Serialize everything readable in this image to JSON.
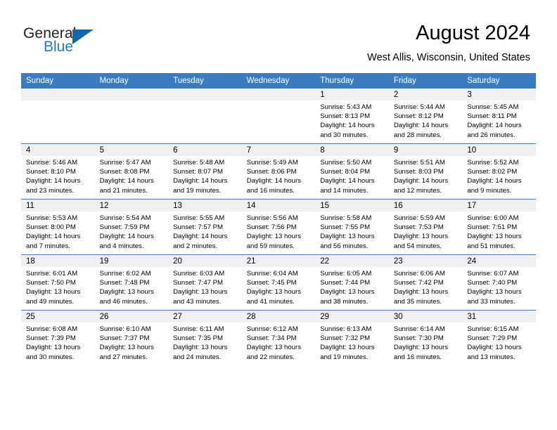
{
  "brand": {
    "name_part1": "General",
    "name_part2": "Blue",
    "triangle_color": "#1166ad",
    "blue_color": "#1f7ac4"
  },
  "header": {
    "title": "August 2024",
    "location": "West Allis, Wisconsin, United States"
  },
  "theme": {
    "header_bar": "#3a7cc0",
    "day_band": "#f0f0f0",
    "text": "#000000"
  },
  "weekday_headers": [
    "Sunday",
    "Monday",
    "Tuesday",
    "Wednesday",
    "Thursday",
    "Friday",
    "Saturday"
  ],
  "weeks": [
    [
      {
        "day": "",
        "sunrise": "",
        "sunset": "",
        "daylight_line1": "",
        "daylight_line2": "",
        "empty": true
      },
      {
        "day": "",
        "sunrise": "",
        "sunset": "",
        "daylight_line1": "",
        "daylight_line2": "",
        "empty": true
      },
      {
        "day": "",
        "sunrise": "",
        "sunset": "",
        "daylight_line1": "",
        "daylight_line2": "",
        "empty": true
      },
      {
        "day": "",
        "sunrise": "",
        "sunset": "",
        "daylight_line1": "",
        "daylight_line2": "",
        "empty": true
      },
      {
        "day": "1",
        "sunrise": "Sunrise: 5:43 AM",
        "sunset": "Sunset: 8:13 PM",
        "daylight_line1": "Daylight: 14 hours",
        "daylight_line2": "and 30 minutes."
      },
      {
        "day": "2",
        "sunrise": "Sunrise: 5:44 AM",
        "sunset": "Sunset: 8:12 PM",
        "daylight_line1": "Daylight: 14 hours",
        "daylight_line2": "and 28 minutes."
      },
      {
        "day": "3",
        "sunrise": "Sunrise: 5:45 AM",
        "sunset": "Sunset: 8:11 PM",
        "daylight_line1": "Daylight: 14 hours",
        "daylight_line2": "and 26 minutes."
      }
    ],
    [
      {
        "day": "4",
        "sunrise": "Sunrise: 5:46 AM",
        "sunset": "Sunset: 8:10 PM",
        "daylight_line1": "Daylight: 14 hours",
        "daylight_line2": "and 23 minutes."
      },
      {
        "day": "5",
        "sunrise": "Sunrise: 5:47 AM",
        "sunset": "Sunset: 8:08 PM",
        "daylight_line1": "Daylight: 14 hours",
        "daylight_line2": "and 21 minutes."
      },
      {
        "day": "6",
        "sunrise": "Sunrise: 5:48 AM",
        "sunset": "Sunset: 8:07 PM",
        "daylight_line1": "Daylight: 14 hours",
        "daylight_line2": "and 19 minutes."
      },
      {
        "day": "7",
        "sunrise": "Sunrise: 5:49 AM",
        "sunset": "Sunset: 8:06 PM",
        "daylight_line1": "Daylight: 14 hours",
        "daylight_line2": "and 16 minutes."
      },
      {
        "day": "8",
        "sunrise": "Sunrise: 5:50 AM",
        "sunset": "Sunset: 8:04 PM",
        "daylight_line1": "Daylight: 14 hours",
        "daylight_line2": "and 14 minutes."
      },
      {
        "day": "9",
        "sunrise": "Sunrise: 5:51 AM",
        "sunset": "Sunset: 8:03 PM",
        "daylight_line1": "Daylight: 14 hours",
        "daylight_line2": "and 12 minutes."
      },
      {
        "day": "10",
        "sunrise": "Sunrise: 5:52 AM",
        "sunset": "Sunset: 8:02 PM",
        "daylight_line1": "Daylight: 14 hours",
        "daylight_line2": "and 9 minutes."
      }
    ],
    [
      {
        "day": "11",
        "sunrise": "Sunrise: 5:53 AM",
        "sunset": "Sunset: 8:00 PM",
        "daylight_line1": "Daylight: 14 hours",
        "daylight_line2": "and 7 minutes."
      },
      {
        "day": "12",
        "sunrise": "Sunrise: 5:54 AM",
        "sunset": "Sunset: 7:59 PM",
        "daylight_line1": "Daylight: 14 hours",
        "daylight_line2": "and 4 minutes."
      },
      {
        "day": "13",
        "sunrise": "Sunrise: 5:55 AM",
        "sunset": "Sunset: 7:57 PM",
        "daylight_line1": "Daylight: 14 hours",
        "daylight_line2": "and 2 minutes."
      },
      {
        "day": "14",
        "sunrise": "Sunrise: 5:56 AM",
        "sunset": "Sunset: 7:56 PM",
        "daylight_line1": "Daylight: 13 hours",
        "daylight_line2": "and 59 minutes."
      },
      {
        "day": "15",
        "sunrise": "Sunrise: 5:58 AM",
        "sunset": "Sunset: 7:55 PM",
        "daylight_line1": "Daylight: 13 hours",
        "daylight_line2": "and 56 minutes."
      },
      {
        "day": "16",
        "sunrise": "Sunrise: 5:59 AM",
        "sunset": "Sunset: 7:53 PM",
        "daylight_line1": "Daylight: 13 hours",
        "daylight_line2": "and 54 minutes."
      },
      {
        "day": "17",
        "sunrise": "Sunrise: 6:00 AM",
        "sunset": "Sunset: 7:51 PM",
        "daylight_line1": "Daylight: 13 hours",
        "daylight_line2": "and 51 minutes."
      }
    ],
    [
      {
        "day": "18",
        "sunrise": "Sunrise: 6:01 AM",
        "sunset": "Sunset: 7:50 PM",
        "daylight_line1": "Daylight: 13 hours",
        "daylight_line2": "and 49 minutes."
      },
      {
        "day": "19",
        "sunrise": "Sunrise: 6:02 AM",
        "sunset": "Sunset: 7:48 PM",
        "daylight_line1": "Daylight: 13 hours",
        "daylight_line2": "and 46 minutes."
      },
      {
        "day": "20",
        "sunrise": "Sunrise: 6:03 AM",
        "sunset": "Sunset: 7:47 PM",
        "daylight_line1": "Daylight: 13 hours",
        "daylight_line2": "and 43 minutes."
      },
      {
        "day": "21",
        "sunrise": "Sunrise: 6:04 AM",
        "sunset": "Sunset: 7:45 PM",
        "daylight_line1": "Daylight: 13 hours",
        "daylight_line2": "and 41 minutes."
      },
      {
        "day": "22",
        "sunrise": "Sunrise: 6:05 AM",
        "sunset": "Sunset: 7:44 PM",
        "daylight_line1": "Daylight: 13 hours",
        "daylight_line2": "and 38 minutes."
      },
      {
        "day": "23",
        "sunrise": "Sunrise: 6:06 AM",
        "sunset": "Sunset: 7:42 PM",
        "daylight_line1": "Daylight: 13 hours",
        "daylight_line2": "and 35 minutes."
      },
      {
        "day": "24",
        "sunrise": "Sunrise: 6:07 AM",
        "sunset": "Sunset: 7:40 PM",
        "daylight_line1": "Daylight: 13 hours",
        "daylight_line2": "and 33 minutes."
      }
    ],
    [
      {
        "day": "25",
        "sunrise": "Sunrise: 6:08 AM",
        "sunset": "Sunset: 7:39 PM",
        "daylight_line1": "Daylight: 13 hours",
        "daylight_line2": "and 30 minutes."
      },
      {
        "day": "26",
        "sunrise": "Sunrise: 6:10 AM",
        "sunset": "Sunset: 7:37 PM",
        "daylight_line1": "Daylight: 13 hours",
        "daylight_line2": "and 27 minutes."
      },
      {
        "day": "27",
        "sunrise": "Sunrise: 6:11 AM",
        "sunset": "Sunset: 7:35 PM",
        "daylight_line1": "Daylight: 13 hours",
        "daylight_line2": "and 24 minutes."
      },
      {
        "day": "28",
        "sunrise": "Sunrise: 6:12 AM",
        "sunset": "Sunset: 7:34 PM",
        "daylight_line1": "Daylight: 13 hours",
        "daylight_line2": "and 22 minutes."
      },
      {
        "day": "29",
        "sunrise": "Sunrise: 6:13 AM",
        "sunset": "Sunset: 7:32 PM",
        "daylight_line1": "Daylight: 13 hours",
        "daylight_line2": "and 19 minutes."
      },
      {
        "day": "30",
        "sunrise": "Sunrise: 6:14 AM",
        "sunset": "Sunset: 7:30 PM",
        "daylight_line1": "Daylight: 13 hours",
        "daylight_line2": "and 16 minutes."
      },
      {
        "day": "31",
        "sunrise": "Sunrise: 6:15 AM",
        "sunset": "Sunset: 7:29 PM",
        "daylight_line1": "Daylight: 13 hours",
        "daylight_line2": "and 13 minutes."
      }
    ]
  ]
}
